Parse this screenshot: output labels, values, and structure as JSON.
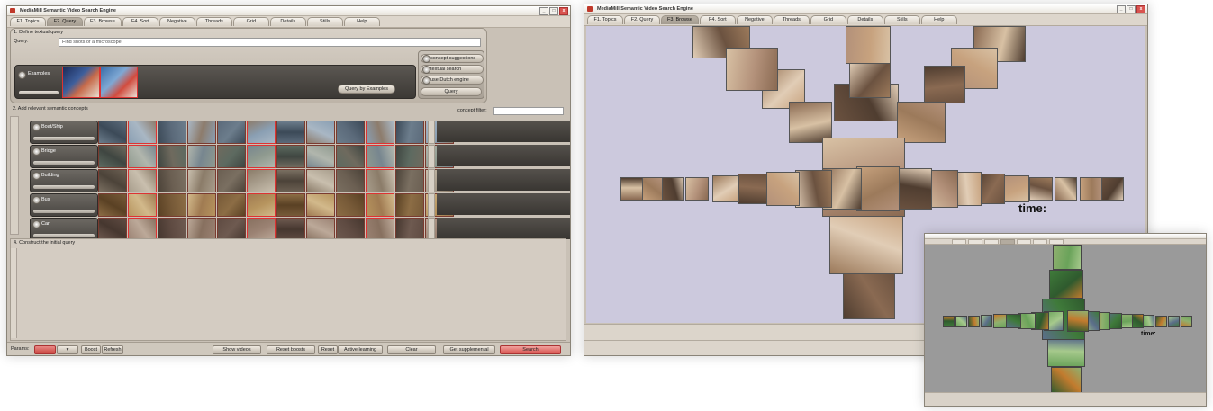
{
  "app": {
    "title": "MediaMill Semantic Video Search Engine",
    "tabs": [
      "F1. Topics",
      "F2. Query",
      "F3. Browse",
      "F4. Sort",
      "Negative",
      "Threads",
      "Grid",
      "Details",
      "Stills",
      "Help"
    ],
    "window_controls": [
      "_",
      "□",
      "x"
    ]
  },
  "query_window": {
    "active_tab_index": 1,
    "step1_label": "1. Define textual query",
    "query_label": "Query:",
    "query_value": "Find shots of a microscope",
    "examples_label": "Examples",
    "query_by_examples_button": "Query by Examples",
    "options": [
      "concept suggestions",
      "textual search",
      "use Dutch engine"
    ],
    "query_button": "Query",
    "step2_label": "2. Add relevant semantic concepts",
    "concept_filter_label": "concept filter:",
    "concepts": [
      "Boat/Ship",
      "Bridge",
      "Building",
      "Bus",
      "Car"
    ],
    "step4_label": "4. Construct the initial query",
    "status_buttons": [
      "Show videos",
      "Reset boosts",
      "Reset",
      "Active learning",
      "Clear",
      "Get supplemental",
      "Search"
    ],
    "params_label": "Params:",
    "small_buttons": [
      "Boost",
      "Refresh"
    ]
  },
  "browse_window": {
    "active_tab_index": 2,
    "time_label": "time:",
    "colors": {
      "canvas": "#ccc9dd"
    }
  },
  "browse_small_window": {
    "time_label": "time:",
    "colors": {
      "canvas": "#9a9a9a"
    }
  },
  "colors": {
    "chrome": "#c9c1b6",
    "panel_dark": "#444140",
    "accent_red": "#d9534f"
  }
}
